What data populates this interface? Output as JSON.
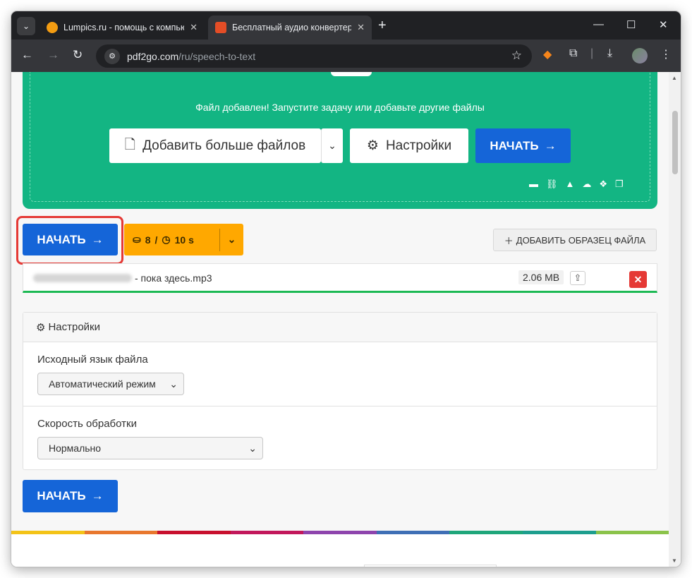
{
  "browser": {
    "tabs": [
      {
        "title": "Lumpics.ru - помощь с компьютером"
      },
      {
        "title": "Бесплатный аудио конвертер онлайн"
      }
    ],
    "url_domain": "pdf2go.com",
    "url_path": "/ru/speech-to-text"
  },
  "upload": {
    "message": "Файл добавлен! Запустите задачу или добавьте другие файлы",
    "add_more_label": "Добавить больше файлов",
    "settings_label": "Настройки",
    "start_label": "НАЧАТЬ"
  },
  "actions": {
    "start_label": "НАЧАТЬ",
    "credits": "8",
    "time": "10 s",
    "sample_label": "ДОБАВИТЬ ОБРАЗЕЦ ФАЙЛА"
  },
  "file": {
    "name": "- пока здесь.mp3",
    "size": "2.06 MB"
  },
  "settings": {
    "title": "Настройки",
    "language_label": "Исходный язык файла",
    "language_value": "Автоматический режим",
    "speed_label": "Скорость обработки",
    "speed_value": "Нормально"
  },
  "footer": {
    "start_label": "НАЧАТЬ",
    "stripe_colors": [
      "#f3c318",
      "#e8772e",
      "#c8102e",
      "#c2185b",
      "#8e44ad",
      "#3f6fb5",
      "#1fa67a",
      "#1e9e8e",
      "#8bc34a"
    ]
  }
}
